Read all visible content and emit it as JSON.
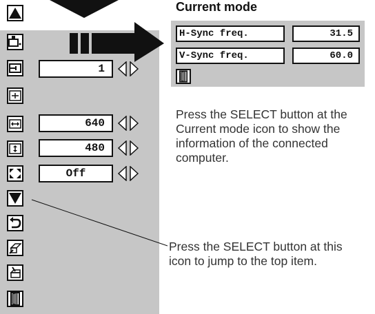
{
  "current_mode": {
    "title": "Current mode",
    "rows": [
      {
        "label": "H-Sync freq.",
        "value": "31.5"
      },
      {
        "label": "V-Sync freq.",
        "value": "60.0"
      }
    ]
  },
  "menu": {
    "icons": [
      "up-arrow-icon",
      "current-mode-icon",
      "clamp-icon",
      "display-area-icon",
      "horizontal-size-icon",
      "vertical-size-icon",
      "full-screen-icon",
      "down-arrow-icon",
      "reset-icon",
      "mode-free-icon",
      "store-icon",
      "quit-icon"
    ],
    "fields": {
      "clamp": "1",
      "h_size": "640",
      "v_size": "480",
      "full_screen": "Off"
    }
  },
  "notes": {
    "current_mode": "Press the SELECT button at the Current mode icon to show the information of the connected computer.",
    "down_arrow": "Press the SELECT button at this icon to jump to the top item."
  },
  "colors": {
    "panel": "#c6c6c6",
    "border": "#111111"
  }
}
